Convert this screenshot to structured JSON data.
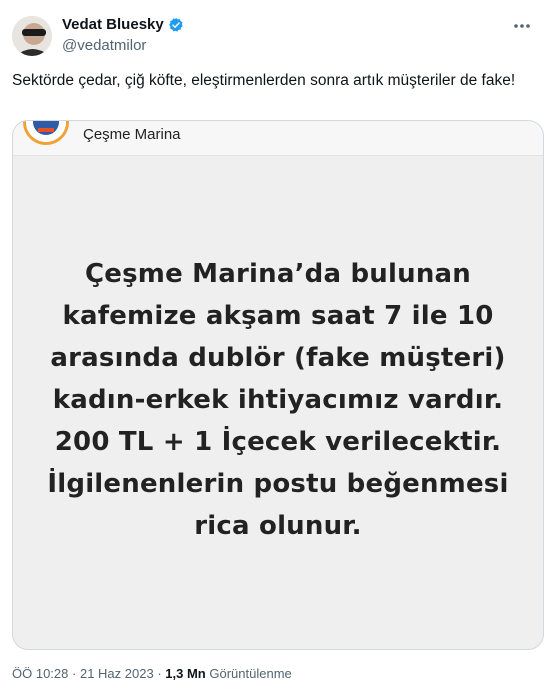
{
  "author": {
    "name": "Vedat Bluesky",
    "handle": "@vedatmilor",
    "verified_color": "#1d9bf0"
  },
  "tweet": {
    "text": "Sektörde çedar, çiğ köfte, eleştirmenlerden sonra artık müşteriler de fake!"
  },
  "media": {
    "account_name": "Çeşme Marina",
    "story_text": "Çeşme Marina’da bulunan kafemize akşam saat 7 ile 10 arasında dublör (fake müşteri) kadın-erkek ihtiyacımız vardır. 200 TL + 1 İçecek verilecektir. İlgilenenlerin postu beğenmesi rica olunur."
  },
  "meta": {
    "time": "ÖÖ 10:28",
    "separator": "·",
    "date": "21 Haz 2023",
    "views_count": "1,3 Mn",
    "views_label": "Görüntülenme"
  },
  "icons": {
    "more": "more-options-icon",
    "verified": "verified-badge-icon"
  }
}
